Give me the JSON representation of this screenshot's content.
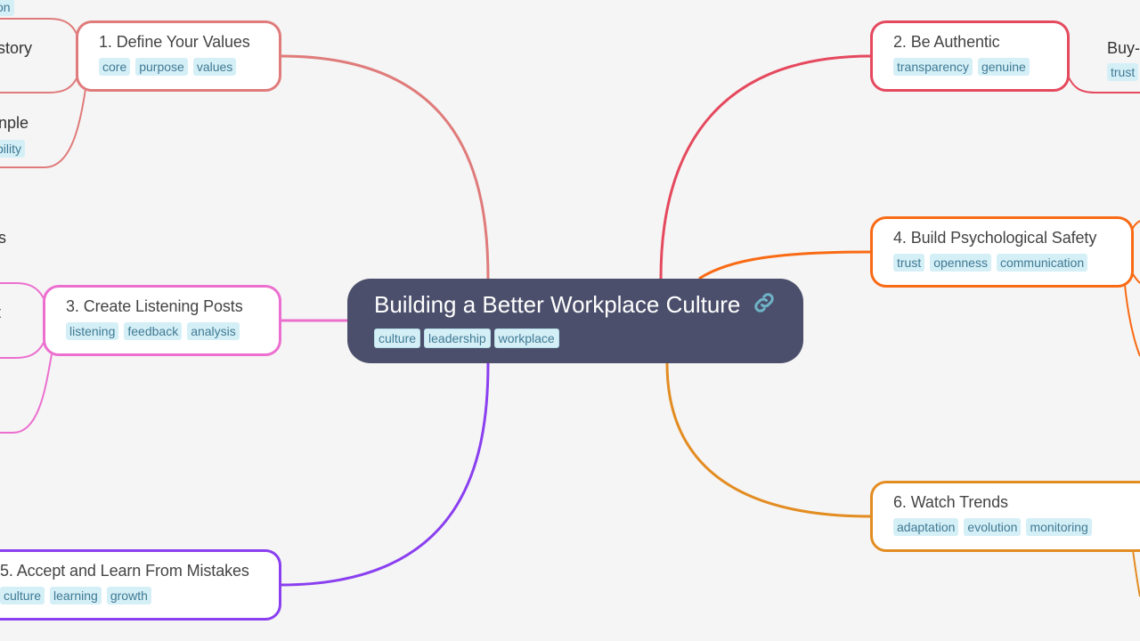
{
  "root": {
    "title": "Building a Better Workplace Culture",
    "icon": "link-icon",
    "tags": [
      "culture",
      "leadership",
      "workplace"
    ]
  },
  "branches": [
    {
      "id": "b1",
      "title": "1. Define Your Values",
      "tags": [
        "core",
        "purpose",
        "values"
      ],
      "color": "#e07b7b"
    },
    {
      "id": "b2",
      "title": "2. Be Authentic",
      "tags": [
        "transparency",
        "genuine"
      ],
      "color": "#e5495e"
    },
    {
      "id": "b3",
      "title": "3. Create Listening Posts",
      "tags": [
        "listening",
        "feedback",
        "analysis"
      ],
      "color": "#ec6fcf"
    },
    {
      "id": "b4",
      "title": "4. Build Psychological Safety",
      "tags": [
        "trust",
        "openness",
        "communication"
      ],
      "color": "#f96a14"
    },
    {
      "id": "b5",
      "title": "5. Accept and Learn From Mistakes",
      "tags": [
        "culture",
        "learning",
        "growth"
      ],
      "color": "#8a3ff0"
    },
    {
      "id": "b6",
      "title": "6. Watch Trends",
      "tags": [
        "adaptation",
        "evolution",
        "monitoring"
      ],
      "color": "#e38c21"
    }
  ],
  "partial_children": {
    "top_tag": "on",
    "story": "story",
    "example": "nple",
    "example_tag": "bility",
    "s_text": "s",
    "t_text": "t",
    "buy_title": "Buy-",
    "buy_tag": "trust"
  }
}
